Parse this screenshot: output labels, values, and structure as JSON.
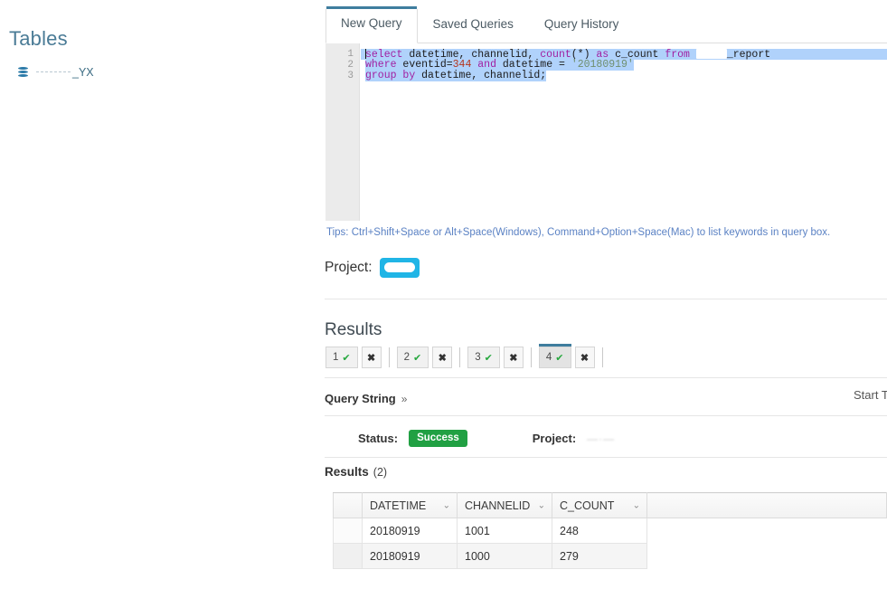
{
  "sidebar": {
    "title": "Tables",
    "items": [
      {
        "icon": "database-icon",
        "name_suffix": "_YX",
        "redacted": true
      }
    ]
  },
  "main": {
    "tabs": [
      {
        "label": "New Query",
        "active": true
      },
      {
        "label": "Saved Queries",
        "active": false
      },
      {
        "label": "Query History",
        "active": false
      }
    ],
    "editor": {
      "line_numbers": [
        "1",
        "2",
        "3"
      ],
      "lines": [
        {
          "number": "1",
          "selected": "full",
          "tokens": [
            {
              "t": "select",
              "c": "kw"
            },
            {
              "t": " datetime, channelid, ",
              "c": "id"
            },
            {
              "t": "count",
              "c": "fn"
            },
            {
              "t": "(*) ",
              "c": "op"
            },
            {
              "t": "as",
              "c": "kw"
            },
            {
              "t": " c_count ",
              "c": "id"
            },
            {
              "t": "from",
              "c": "kw"
            },
            {
              "t": " ",
              "c": "id"
            },
            {
              "t": "[redacted]",
              "c": "redact"
            },
            {
              "t": "_report",
              "c": "id"
            }
          ]
        },
        {
          "number": "2",
          "selected": "partial",
          "tokens": [
            {
              "t": "where",
              "c": "kw"
            },
            {
              "t": " eventid=",
              "c": "id"
            },
            {
              "t": "344",
              "c": "num"
            },
            {
              "t": " ",
              "c": "id"
            },
            {
              "t": "and",
              "c": "kw"
            },
            {
              "t": " datetime ",
              "c": "id"
            },
            {
              "t": "= ",
              "c": "op"
            },
            {
              "t": "'20180919'",
              "c": "str"
            }
          ]
        },
        {
          "number": "3",
          "selected": "partial",
          "tokens": [
            {
              "t": "group",
              "c": "kw"
            },
            {
              "t": " ",
              "c": "id"
            },
            {
              "t": "by",
              "c": "kw"
            },
            {
              "t": " datetime, channelid;",
              "c": "id"
            }
          ]
        }
      ]
    },
    "tips": "Tips: Ctrl+Shift+Space or Alt+Space(Windows), Command+Option+Space(Mac) to list keywords in query box.",
    "project": {
      "label": "Project:",
      "value": "",
      "redacted": true,
      "badge_color": "#20b5e6"
    },
    "results": {
      "heading": "Results",
      "tabs": [
        {
          "label": "1",
          "status": "ok",
          "active": false,
          "close": "✖"
        },
        {
          "label": "2",
          "status": "ok",
          "active": false,
          "close": "✖"
        },
        {
          "label": "3",
          "status": "ok",
          "active": false,
          "close": "✖"
        },
        {
          "label": "4",
          "status": "ok",
          "active": true,
          "close": "✖"
        }
      ],
      "check_glyph": "✔",
      "check_color": "#27a83f",
      "query_string_label": "Query String",
      "expand_glyph": "»",
      "start_time_label": "Start T",
      "status_label": "Status:",
      "status_value": "Success",
      "status_color": "#21a043",
      "project_label": "Project:",
      "project_value": "—·—",
      "results_count_label": "Results",
      "results_count_value": "(2)",
      "table": {
        "columns": [
          "DATETIME",
          "CHANNELID",
          "C_COUNT"
        ],
        "sort_glyph": "⌄",
        "rows": [
          [
            "20180919",
            "1001",
            "248"
          ],
          [
            "20180919",
            "1000",
            "279"
          ]
        ]
      }
    }
  }
}
